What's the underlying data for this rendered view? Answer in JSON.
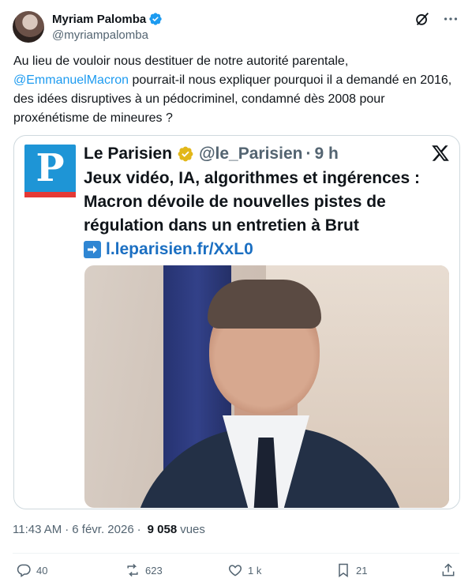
{
  "author": {
    "display_name": "Myriam Palomba",
    "handle": "@myriampalomba",
    "verified_icon": "verified-badge-icon"
  },
  "tweet": {
    "text_before": "Au lieu de vouloir nous destituer de notre autorité parentale,",
    "mention": "@EmmanuelMacron",
    "text_after": " pourrait-il nous expliquer pourquoi il a demandé en 2016, des idées disruptives à un pédocriminel, condamné dès 2008 pour proxénétisme de mineures ?"
  },
  "embedded": {
    "name": "Le Parisien",
    "handle": "@le_Parisien",
    "separator": "·",
    "time": "9 h",
    "logo_letter": "P",
    "title": "Jeux vidéo, IA, algorithmes et ingérences : Macron dévoile de nouvelles pistes de régulation dans un entretien à Brut",
    "link": "l.leparisien.fr/XxL0"
  },
  "meta": {
    "time": "11:43 AM",
    "separator": "·",
    "date": "6 févr. 2026",
    "views_count": "9 058",
    "views_label": "vues"
  },
  "actions": {
    "replies": "40",
    "reposts": "623",
    "likes": "1 k",
    "bookmarks": "21"
  },
  "colors": {
    "accent": "#1d9bf0",
    "text_primary": "#0f1419",
    "text_secondary": "#536471",
    "border": "#cfd9de",
    "gold_badge": "#e2b719",
    "parisien_blue": "#1e95d6",
    "parisien_red": "#e53935"
  }
}
